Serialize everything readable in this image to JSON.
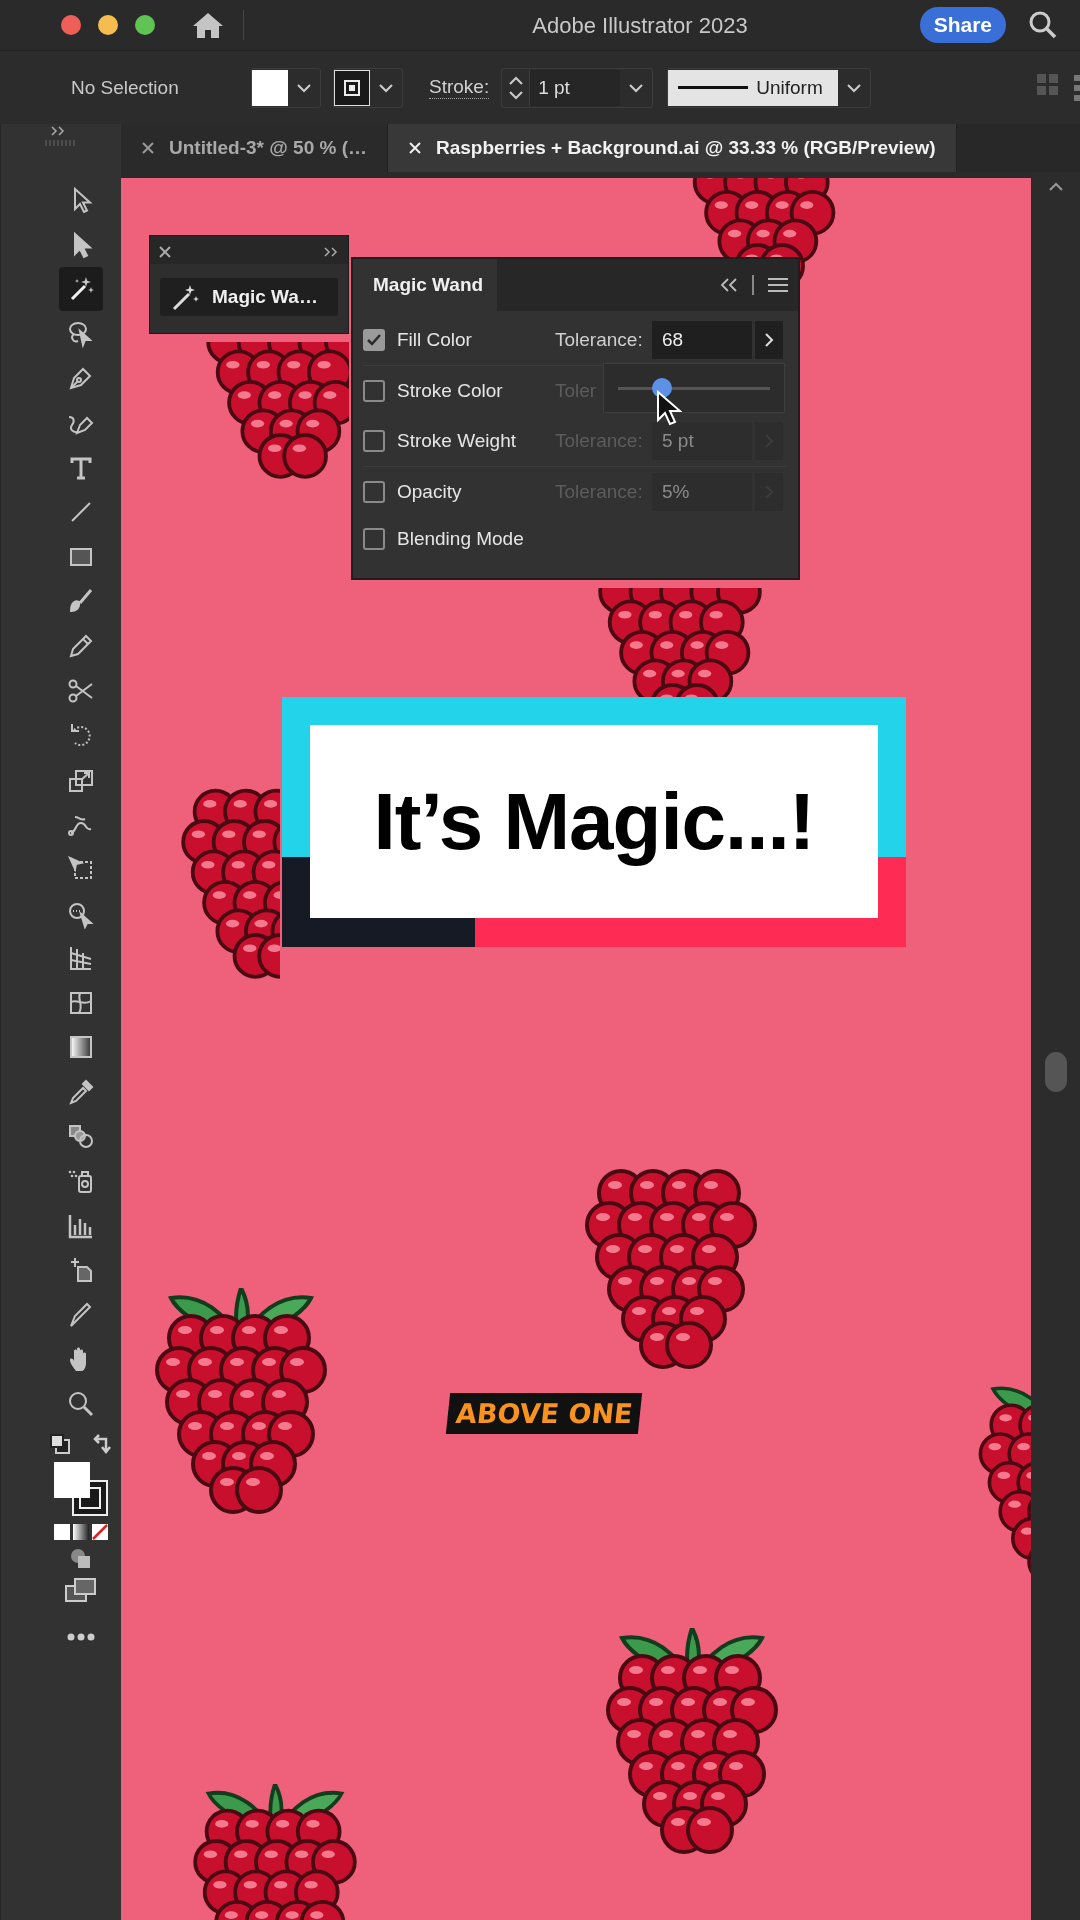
{
  "window": {
    "title": "Adobe Illustrator 2023",
    "share_button": "Share"
  },
  "control_bar": {
    "selection": "No Selection",
    "stroke_label": "Stroke:",
    "stroke_weight": "1 pt",
    "stroke_profile": "Uniform"
  },
  "document_tabs": [
    {
      "label": "Untitled-3* @ 50 % (…",
      "selected": false
    },
    {
      "label": "Raspberries + Background.ai @ 33.33 % (RGB/Preview)",
      "selected": true
    }
  ],
  "tools": [
    {
      "kind": "select",
      "selected": false
    },
    {
      "kind": "direct",
      "selected": false
    },
    {
      "kind": "wand",
      "selected": true
    },
    {
      "kind": "lasso",
      "selected": false
    },
    {
      "kind": "pen",
      "selected": false
    },
    {
      "kind": "curvature",
      "selected": false
    },
    {
      "kind": "type",
      "selected": false
    },
    {
      "kind": "line",
      "selected": false
    },
    {
      "kind": "rect",
      "selected": false
    },
    {
      "kind": "brush",
      "selected": false
    },
    {
      "kind": "pencil",
      "selected": false
    },
    {
      "kind": "scissors",
      "selected": false
    },
    {
      "kind": "rotate",
      "selected": false
    },
    {
      "kind": "scale",
      "selected": false
    },
    {
      "kind": "warp",
      "selected": false
    },
    {
      "kind": "transform",
      "selected": false
    },
    {
      "kind": "shapebuilder",
      "selected": false
    },
    {
      "kind": "perspective",
      "selected": false
    },
    {
      "kind": "mesh",
      "selected": false
    },
    {
      "kind": "gradient",
      "selected": false
    },
    {
      "kind": "eyedropper",
      "selected": false
    },
    {
      "kind": "blend",
      "selected": false
    },
    {
      "kind": "sprayer",
      "selected": false
    },
    {
      "kind": "graph",
      "selected": false
    },
    {
      "kind": "artboard",
      "selected": false
    },
    {
      "kind": "slice",
      "selected": false
    },
    {
      "kind": "hand",
      "selected": false
    },
    {
      "kind": "zoom",
      "selected": false
    }
  ],
  "tool_panel": {
    "label": "Magic Wa…"
  },
  "magic_wand_panel": {
    "title": "Magic Wand",
    "options": [
      {
        "label": "Fill Color",
        "checked": true,
        "tolerance": {
          "label": "Tolerance:",
          "value": "68",
          "disabled": false
        }
      },
      {
        "label": "Stroke Color",
        "checked": false,
        "tolerance": {
          "label": "Toler",
          "disabled": true
        }
      },
      {
        "label": "Stroke Weight",
        "checked": false,
        "tolerance": {
          "label": "Tolerance:",
          "value": "5 pt",
          "disabled": true
        }
      },
      {
        "label": "Opacity",
        "checked": false,
        "tolerance": {
          "label": "Tolerance:",
          "value": "5%",
          "disabled": true
        }
      },
      {
        "label": "Blending Mode",
        "checked": false
      }
    ],
    "tolerance_slider": {
      "level": 0.29
    }
  },
  "caption": "It’s Magic...!",
  "badge": "ABOVE ONE"
}
